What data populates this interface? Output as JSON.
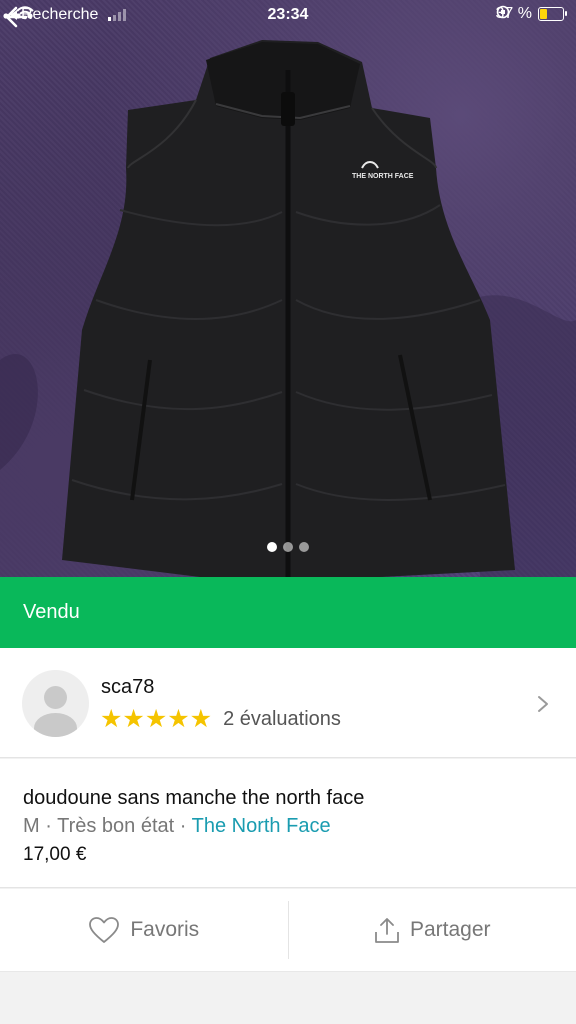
{
  "status_bar": {
    "back_app": "Recherche",
    "time": "23:34",
    "battery": "37 %",
    "battery_level": 0.37,
    "signal_bars_active": 1,
    "signal_bars_total": 4
  },
  "photo": {
    "brand_logo": "THE NORTH FACE",
    "pages_total": 3,
    "page_current": 1
  },
  "banner": {
    "label": "Vendu",
    "color": "#09b85a"
  },
  "seller": {
    "username": "sca78",
    "stars": "★★★★★",
    "rating": 5,
    "reviews": "2 évaluations"
  },
  "item": {
    "title": "doudoune sans manche the north face",
    "size": "M",
    "separator": " · ",
    "condition": "Très bon état",
    "brand": "The North Face",
    "price": "17,00 €"
  },
  "actions": {
    "favorite_label": "Favoris",
    "share_label": "Partager"
  },
  "icons": {
    "back": "arrow-left-icon",
    "more": "more-dots-icon",
    "favorite": "heart-icon",
    "share": "share-icon",
    "chevron": "chevron-right-icon"
  },
  "colors": {
    "accent": "#09b85a",
    "brand_link": "#1a9cb0",
    "star": "#f5c400"
  }
}
